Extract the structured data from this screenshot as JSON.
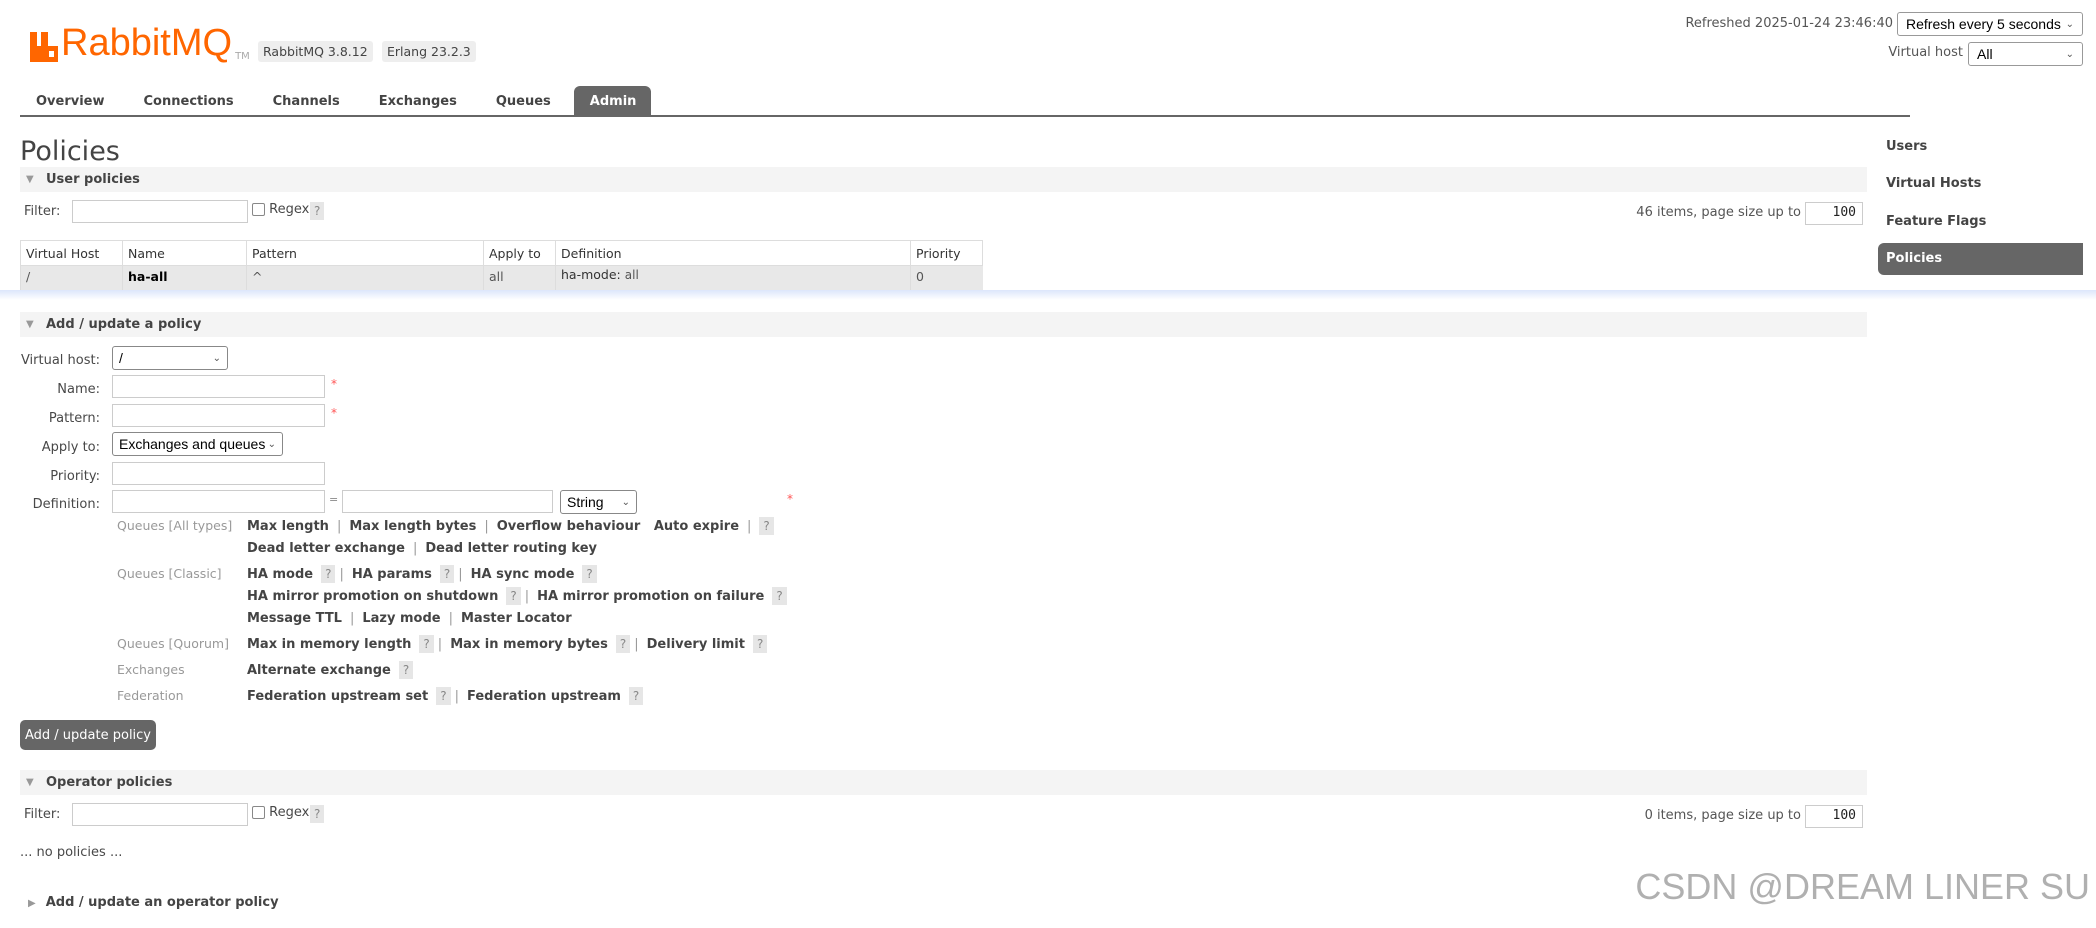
{
  "header": {
    "logo_text": "RabbitMQ",
    "logo_tm": "TM",
    "version": "RabbitMQ 3.8.12",
    "erlang": "Erlang 23.2.3",
    "refreshed": "Refreshed 2025-01-24 23:46:40",
    "refresh_select": "Refresh every 5 seconds",
    "vhost_label": "Virtual host",
    "vhost_select": "All",
    "brand_color": "#ff6600"
  },
  "tabs": [
    {
      "label": "Overview"
    },
    {
      "label": "Connections"
    },
    {
      "label": "Channels"
    },
    {
      "label": "Exchanges"
    },
    {
      "label": "Queues"
    },
    {
      "label": "Admin",
      "active": true
    }
  ],
  "page_title": "Policies",
  "sidebar": {
    "items": [
      {
        "label": "Users"
      },
      {
        "label": "Virtual Hosts"
      },
      {
        "label": "Feature Flags"
      },
      {
        "label": "Policies",
        "active": true
      }
    ]
  },
  "user_policies": {
    "title": "User policies",
    "filter_label": "Filter:",
    "regex_label": "Regex",
    "help": "?",
    "count_text": "46 items, page size up to",
    "page_size": "100",
    "columns": [
      "Virtual Host",
      "Name",
      "Pattern",
      "Apply to",
      "Definition",
      "Priority"
    ],
    "rows": [
      {
        "vhost": "/",
        "name": "ha-all",
        "pattern": "^",
        "apply_to": "all",
        "def_key": "ha-mode:",
        "def_val": "all",
        "priority": "0"
      }
    ]
  },
  "add_policy": {
    "title": "Add / update a policy",
    "vhost_label": "Virtual host:",
    "vhost_value": "/",
    "name_label": "Name:",
    "pattern_label": "Pattern:",
    "apply_label": "Apply to:",
    "apply_value": "Exchanges and queues",
    "priority_label": "Priority:",
    "definition_label": "Definition:",
    "equals": "=",
    "type_value": "String",
    "required": "*",
    "help_groups": {
      "all": {
        "label": "Queues [All types]",
        "l1": [
          "Max length",
          "Max length bytes",
          "Overflow behaviour",
          "Auto expire"
        ],
        "l2": [
          "Dead letter exchange",
          "Dead letter routing key"
        ]
      },
      "classic": {
        "label": "Queues [Classic]",
        "l1": [
          "HA mode",
          "HA params",
          "HA sync mode"
        ],
        "l2": [
          "HA mirror promotion on shutdown",
          "HA mirror promotion on failure"
        ],
        "l3": [
          "Message TTL",
          "Lazy mode",
          "Master Locator"
        ]
      },
      "quorum": {
        "label": "Queues [Quorum]",
        "l1": [
          "Max in memory length",
          "Max in memory bytes",
          "Delivery limit"
        ]
      },
      "exchanges": {
        "label": "Exchanges",
        "l1": [
          "Alternate exchange"
        ]
      },
      "federation": {
        "label": "Federation",
        "l1": [
          "Federation upstream set",
          "Federation upstream"
        ]
      }
    },
    "submit": "Add / update policy"
  },
  "operator_policies": {
    "title": "Operator policies",
    "filter_label": "Filter:",
    "regex_label": "Regex",
    "help": "?",
    "count_text": "0 items, page size up to",
    "page_size": "100",
    "empty": "... no policies ..."
  },
  "add_operator": {
    "title": "Add / update an operator policy"
  },
  "watermark": "CSDN @DREAM LINER SU"
}
